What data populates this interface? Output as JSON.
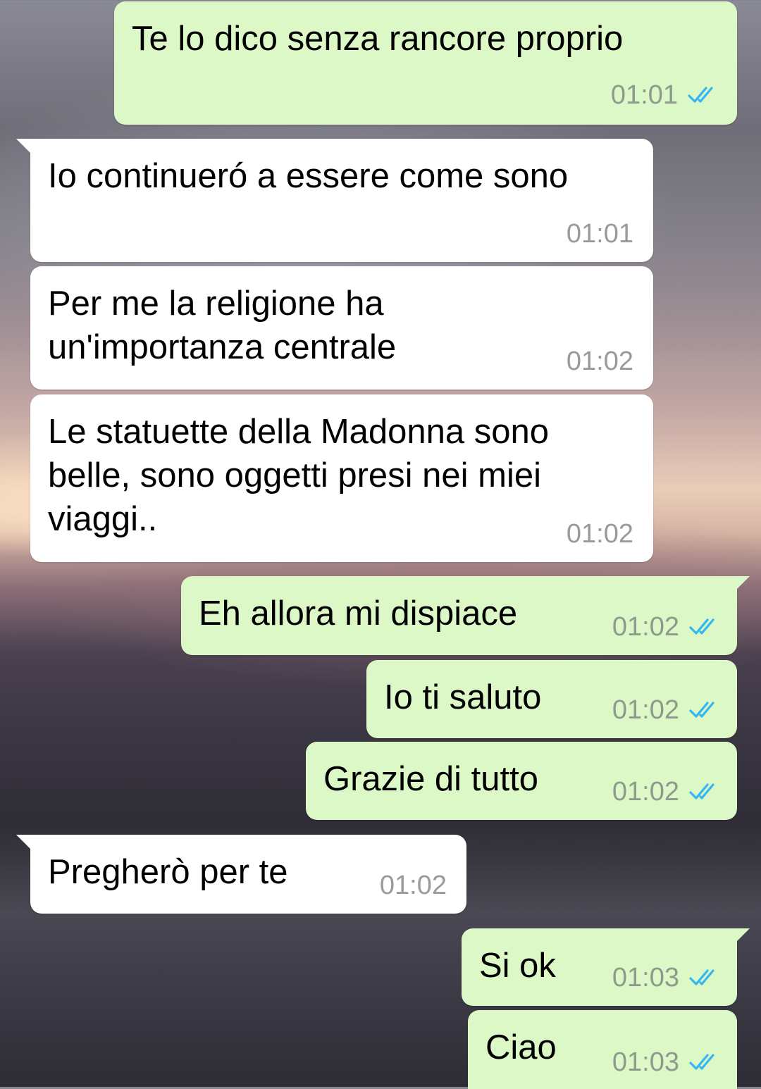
{
  "chat": {
    "messages": [
      {
        "direction": "outgoing",
        "text": "Te lo dico senza rancore proprio",
        "time": "01:01",
        "status": "read"
      },
      {
        "direction": "incoming",
        "text": "Io continueró a essere come sono",
        "time": "01:01"
      },
      {
        "direction": "incoming",
        "text": "Per me la religione ha\nun'importanza centrale",
        "time": "01:02"
      },
      {
        "direction": "incoming",
        "text": "Le statuette della Madonna sono\nbelle, sono oggetti presi nei miei\nviaggi..",
        "time": "01:02"
      },
      {
        "direction": "outgoing",
        "text": "Eh allora mi dispiace",
        "time": "01:02",
        "status": "read"
      },
      {
        "direction": "outgoing",
        "text": "Io ti saluto",
        "time": "01:02",
        "status": "read"
      },
      {
        "direction": "outgoing",
        "text": "Grazie di tutto",
        "time": "01:02",
        "status": "read"
      },
      {
        "direction": "incoming",
        "text": "Pregherò per te",
        "time": "01:02"
      },
      {
        "direction": "outgoing",
        "text": "Si ok",
        "time": "01:03",
        "status": "read"
      },
      {
        "direction": "outgoing",
        "text": "Ciao",
        "time": "01:03",
        "status": "read"
      }
    ]
  },
  "colors": {
    "outgoing_bubble": "#dcf8c6",
    "incoming_bubble": "#ffffff",
    "read_tick": "#34b7f1",
    "timestamp": "#8e9a8c"
  },
  "icons": {
    "read_status": "double-check-icon"
  }
}
